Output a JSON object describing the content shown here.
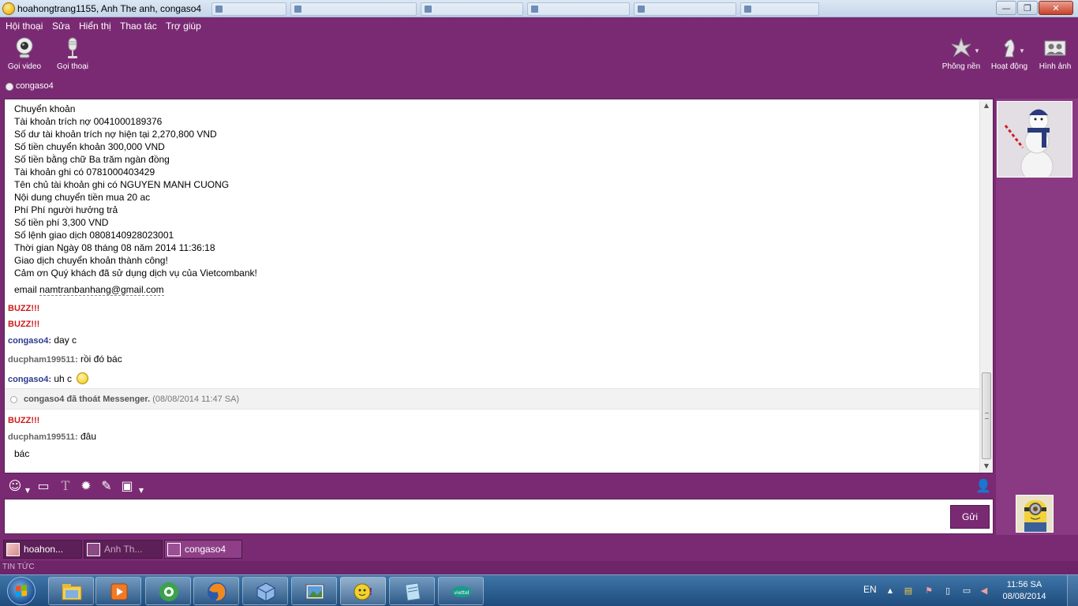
{
  "window": {
    "title": "hoahongtrang1155, Anh The anh, congaso4",
    "controls": {
      "minimize": "—",
      "maximize": "❐",
      "close": "✕"
    }
  },
  "menu": [
    "Hội thoại",
    "Sửa",
    "Hiển thị",
    "Thao tác",
    "Trợ giúp"
  ],
  "toolbar": {
    "left": [
      {
        "label": "Gọi video",
        "icon": "webcam-icon"
      },
      {
        "label": "Gọi thoại",
        "icon": "microphone-icon"
      }
    ],
    "right": [
      {
        "label": "Phông nền",
        "icon": "wallpaper-icon"
      },
      {
        "label": "Hoạt động",
        "icon": "chess-knight-icon"
      },
      {
        "label": "Hình ảnh",
        "icon": "photos-icon"
      }
    ]
  },
  "contact": {
    "name": "congaso4"
  },
  "conversation": {
    "transfer_lines": [
      "Chuyển khoản",
      "Tài khoản trích nợ 0041000189376",
      "Số dư tài khoản trích nợ hiện tại 2,270,800 VND",
      "Số tiền chuyển khoản 300,000 VND",
      "Số tiền bằng chữ Ba trăm ngàn đồng",
      "Tài khoản ghi có 0781000403429",
      "Tên chủ tài khoản ghi có NGUYEN MANH CUONG",
      "Nội dung chuyển tiền mua 20 ac",
      "Phí Phí người hưởng trả",
      "Số tiền phí 3,300 VND",
      "Số lệnh giao dịch 0808140928023001",
      "Thời gian Ngày 08 tháng 08 năm 2014 11:36:18",
      "Giao dịch chuyển khoản thành công!",
      "Cảm ơn Quý khách đã sử dụng dịch vụ của Vietcombank!"
    ],
    "email_label": "email",
    "email_value": "namtranbanhang@gmail.com",
    "buzz": "BUZZ!!!",
    "messages": [
      {
        "nick": "congaso4:",
        "text": "day c"
      },
      {
        "nick": "ducpham199511:",
        "text": "rồi đó bác"
      },
      {
        "nick": "congaso4:",
        "text": "uh c"
      }
    ],
    "system": {
      "text": "congaso4 đã thoát Messenger.",
      "time": "(08/08/2014 11:47 SA)"
    },
    "after": [
      {
        "nick": "ducpham199511:",
        "text": "đâu"
      }
    ],
    "continuation": "bác"
  },
  "compose": {
    "placeholder": "",
    "send_label": "Gửi"
  },
  "tabs": [
    {
      "label": "hoahon...",
      "active": false
    },
    {
      "label": "Anh Th...",
      "active": false
    },
    {
      "label": "congaso4",
      "active": true
    }
  ],
  "news": {
    "label": "TIN TỨC"
  },
  "taskbar": {
    "apps": [
      "explorer-icon",
      "media-player-icon",
      "coccoc-browser-icon",
      "firefox-icon",
      "virtualbox-icon",
      "image-viewer-icon",
      "yahoo-messenger-icon",
      "notepad-icon",
      "viettel-icon"
    ],
    "lang": "EN",
    "time": "11:56 SA",
    "date": "08/08/2014"
  },
  "colors": {
    "accent": "#7a2a73",
    "buzz": "#cc1b1b",
    "self_nick": "#2b3a8a",
    "other_nick": "#666666"
  }
}
